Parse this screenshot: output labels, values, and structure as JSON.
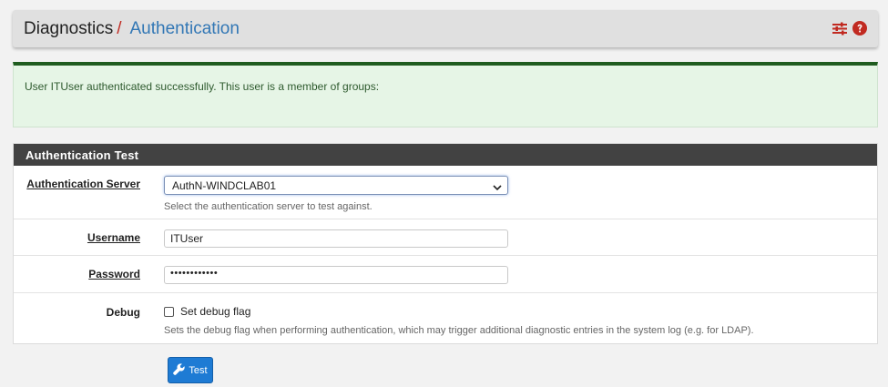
{
  "breadcrumb": {
    "parent": "Diagnostics",
    "separator": "/",
    "current": "Authentication"
  },
  "header_icons": [
    "sliders-icon",
    "help-icon"
  ],
  "alert": {
    "message": "User ITUser authenticated successfully. This user is a member of groups:"
  },
  "panel": {
    "title": "Authentication Test",
    "fields": {
      "server": {
        "label": "Authentication Server",
        "selected": "AuthN-WINDCLAB01",
        "help": "Select the authentication server to test against."
      },
      "username": {
        "label": "Username",
        "value": "ITUser"
      },
      "password": {
        "label": "Password",
        "masked_value": "••••••••••••"
      },
      "debug": {
        "label": "Debug",
        "checkbox_label": "Set debug flag",
        "checked": false,
        "help": "Sets the debug flag when performing authentication, which may trigger additional diagnostic entries in the system log (e.g. for LDAP)."
      }
    }
  },
  "test_button": {
    "label": "Test",
    "icon": "wrench-icon"
  },
  "colors": {
    "accent": "#3277b5",
    "separator": "#c12a21",
    "success_border": "#1f5c1f",
    "success_bg": "#e6f5e6",
    "panel_heading": "#424242",
    "button": "#1e7bd4"
  }
}
